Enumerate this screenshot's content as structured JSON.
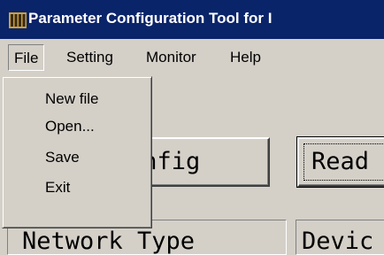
{
  "window": {
    "title": "Parameter Configuration Tool for I",
    "icon": "grid-app-icon"
  },
  "menubar": {
    "items": [
      {
        "label": "File",
        "active": true
      },
      {
        "label": "Setting"
      },
      {
        "label": "Monitor"
      },
      {
        "label": "Help"
      }
    ]
  },
  "file_menu": {
    "items": [
      "New file",
      "Open...",
      "Save",
      "Exit"
    ]
  },
  "main": {
    "config_button": "onfig",
    "read_button": "Read",
    "network_type_label": "Network Type",
    "device_label": "Devic"
  }
}
